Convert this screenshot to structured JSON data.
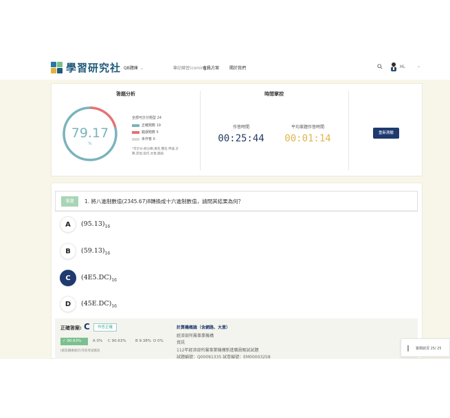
{
  "header": {
    "logo_text": "學習研究社",
    "nav": [
      "QB題庫",
      "筆記練習(coming)",
      "會員方案",
      "關於我們"
    ],
    "greeting": "Hi,"
  },
  "analysis": {
    "title": "答題分析",
    "score": "79.17",
    "unit": "%",
    "donut": {
      "correct": 19,
      "wrong": 5,
      "unanswered": 0,
      "colors": {
        "correct": "#7bb3bd",
        "wrong": "#e57373",
        "unanswered": "#d9d9d9"
      }
    },
    "total_label": "全部可計分題型 24",
    "legend": [
      {
        "label": "正確題數 19",
        "color": "#7bb3bd"
      },
      {
        "label": "錯誤題數 5",
        "color": "#e57373"
      },
      {
        "label": "未作答 0",
        "color": "#d9d9d9"
      }
    ],
    "note": "*可計分:統分類,填充,簡答,申論,計算,其他,寫作,文章,圖表"
  },
  "time": {
    "title": "時間掌控",
    "elapsed_label": "作答時間",
    "elapsed": "00:25:44",
    "avg_label": "平均單題作答時間",
    "avg": "00:01:14"
  },
  "review_button": "重新測驗",
  "question": {
    "tag": "單選",
    "text": "1. 將八進制數值(2345.67)8轉換成十六進制數值，請問其結果為何？",
    "options": [
      {
        "letter": "A",
        "text": "(95.13)",
        "sub": "16"
      },
      {
        "letter": "B",
        "text": "(59.13)",
        "sub": "16"
      },
      {
        "letter": "C",
        "text": "(4E5.DC)",
        "sub": "16"
      },
      {
        "letter": "D",
        "text": "(45E.DC)",
        "sub": "16"
      }
    ]
  },
  "answer": {
    "label": "正確答案:",
    "letter": "C",
    "button": "作答正確",
    "accuracy": "90.63%",
    "dist": [
      "A 0%",
      "C 90.63%",
      "B 9.38%",
      "D 0%"
    ],
    "note": "(統答題庫統計)作答考試資訊",
    "info_title": "計算機概論（含網路、大意）",
    "info_lines": [
      "經濟部所屬事業機構",
      "資訊",
      "112年經濟部所屬事業機構新進職員甄試試題",
      "試題編號：Q00091335   試卷編號：EM00003258"
    ]
  },
  "status": {
    "label": "答題狀況 25/ 25"
  }
}
